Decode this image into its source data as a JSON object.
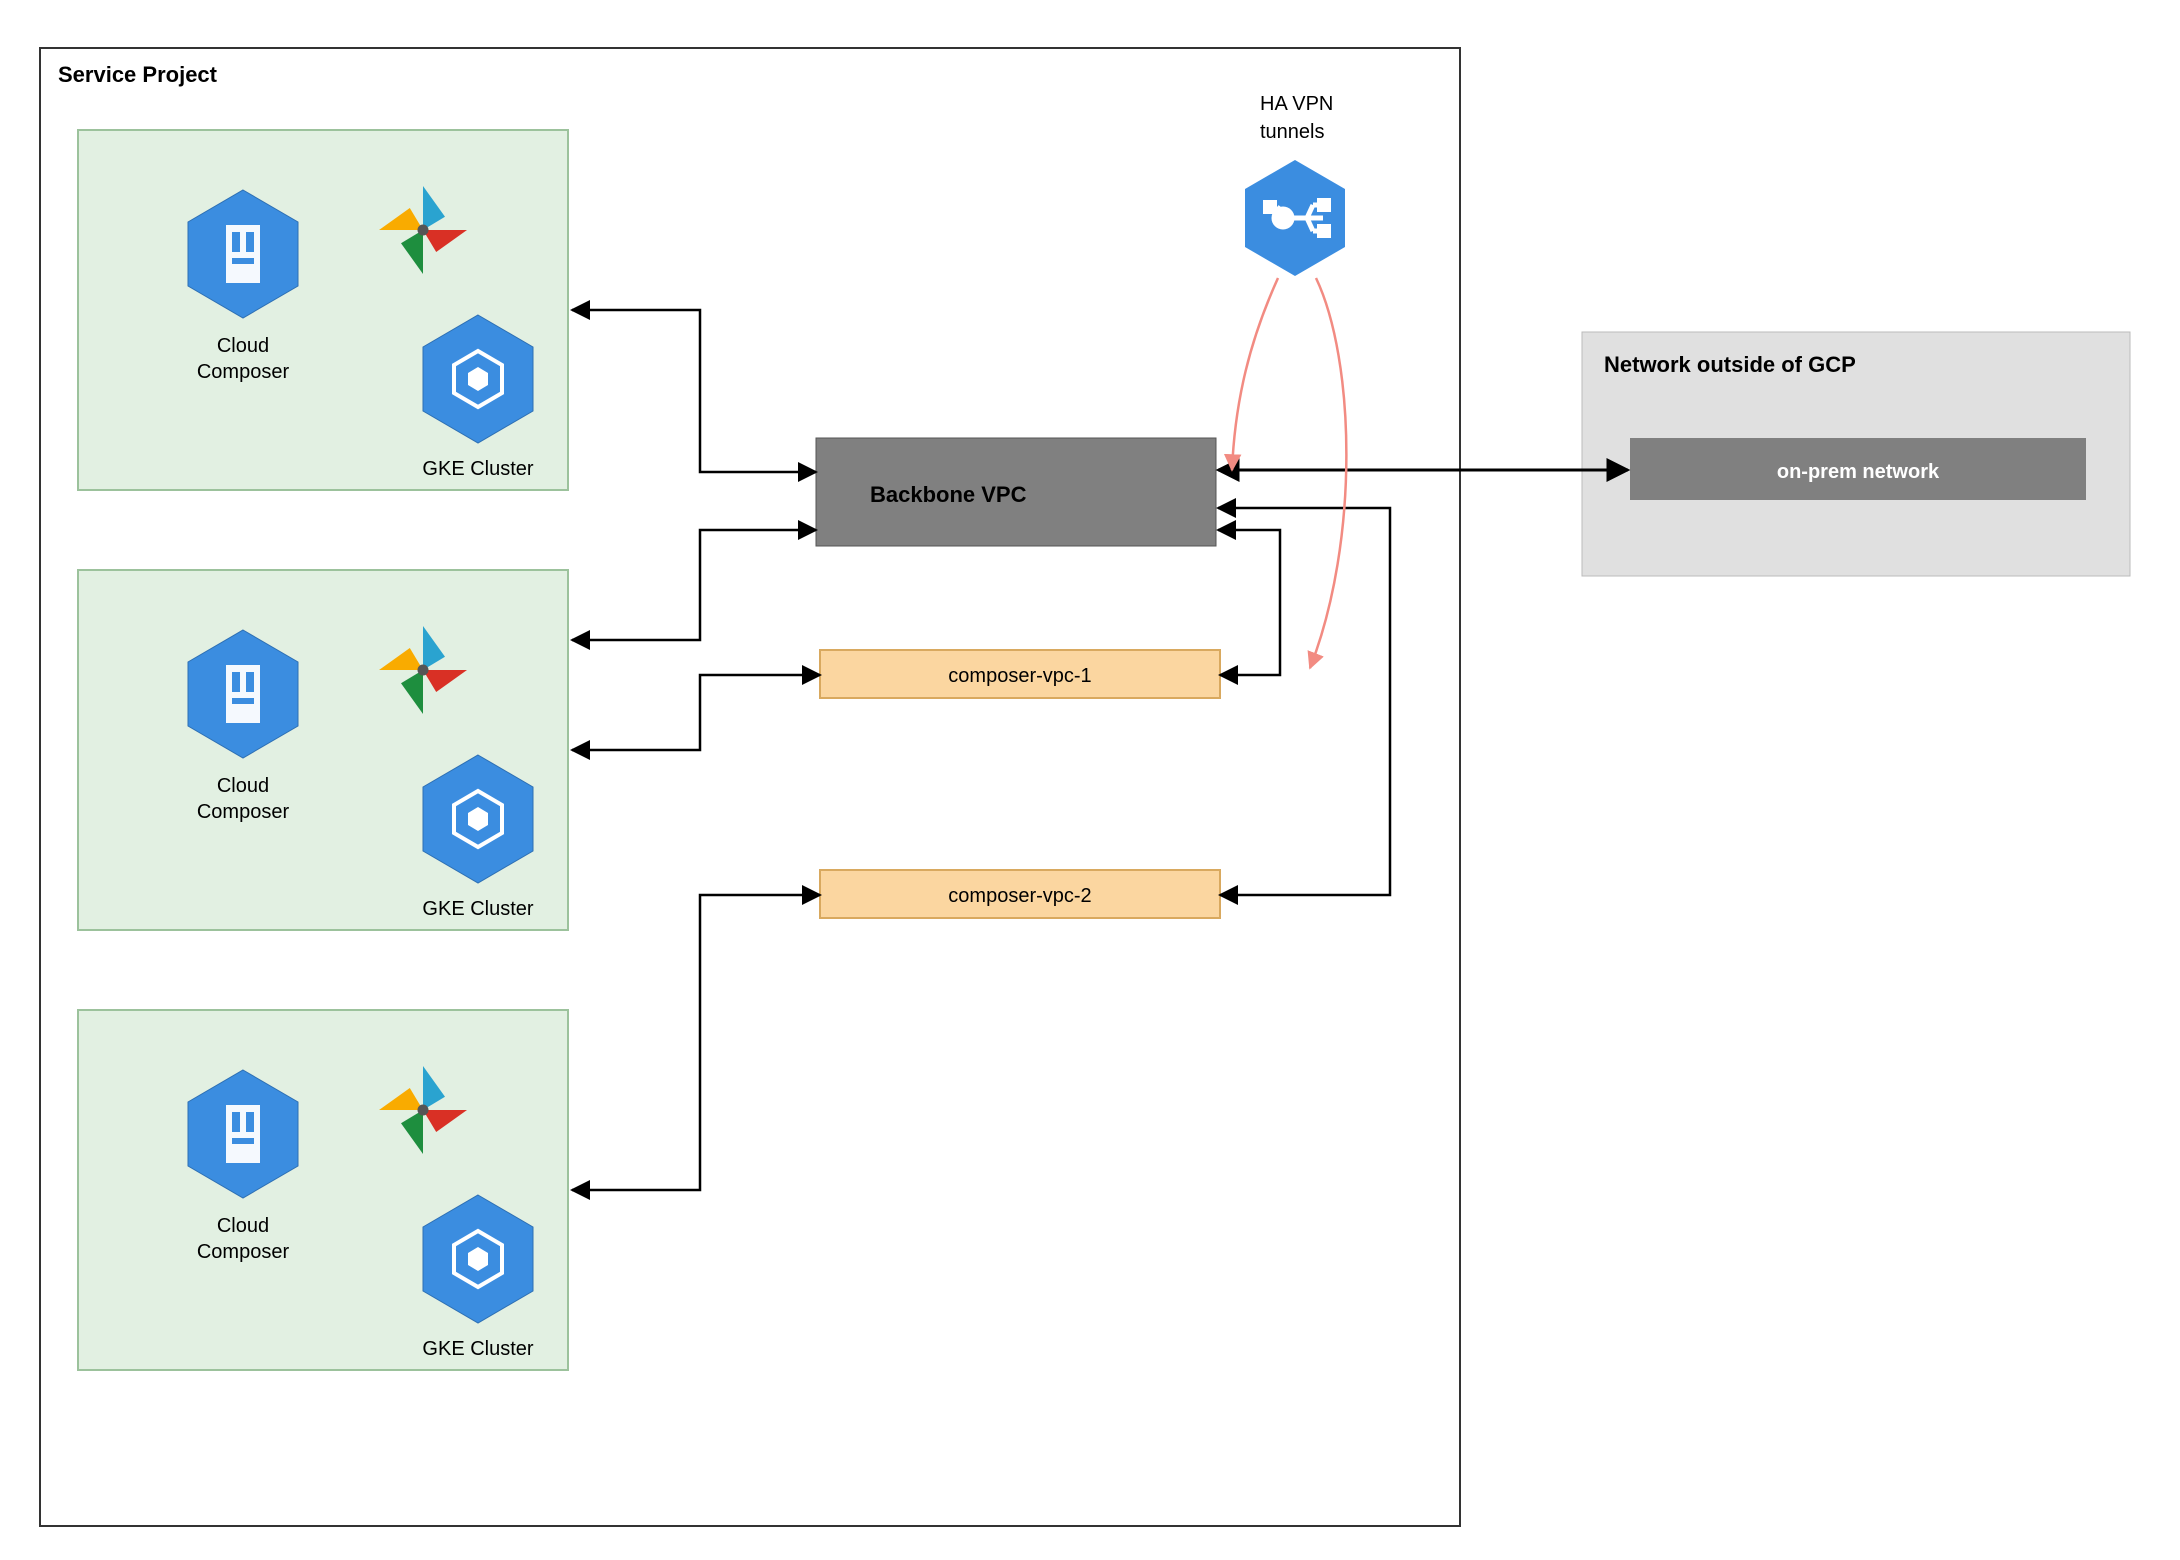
{
  "serviceProject": {
    "title": "Service Project",
    "environments": [
      {
        "composerLabel": "Cloud Composer",
        "gkeLabel": "GKE Cluster"
      },
      {
        "composerLabel": "Cloud Composer",
        "gkeLabel": "GKE Cluster"
      },
      {
        "composerLabel": "Cloud Composer",
        "gkeLabel": "GKE Cluster"
      }
    ]
  },
  "vpn": {
    "label": "HA VPN\ntunnels"
  },
  "backbone": {
    "label": "Backbone VPC"
  },
  "composerVpcs": [
    {
      "label": "composer-vpc-1"
    },
    {
      "label": "composer-vpc-2"
    }
  ],
  "external": {
    "title": "Network outside of GCP",
    "onprem": "on-prem network"
  },
  "colors": {
    "envFill": "#e2f0e2",
    "envStroke": "#9cc29c",
    "hexFill": "#3b8de0",
    "hexStroke": "#2d6fb3",
    "backboneFill": "#808080",
    "composerVpcFill": "#fbd6a0",
    "composerVpcStroke": "#d9a95f",
    "externalFill": "#e0e0e0",
    "onpremFill": "#808080",
    "vpnArrow": "#f28b82"
  }
}
